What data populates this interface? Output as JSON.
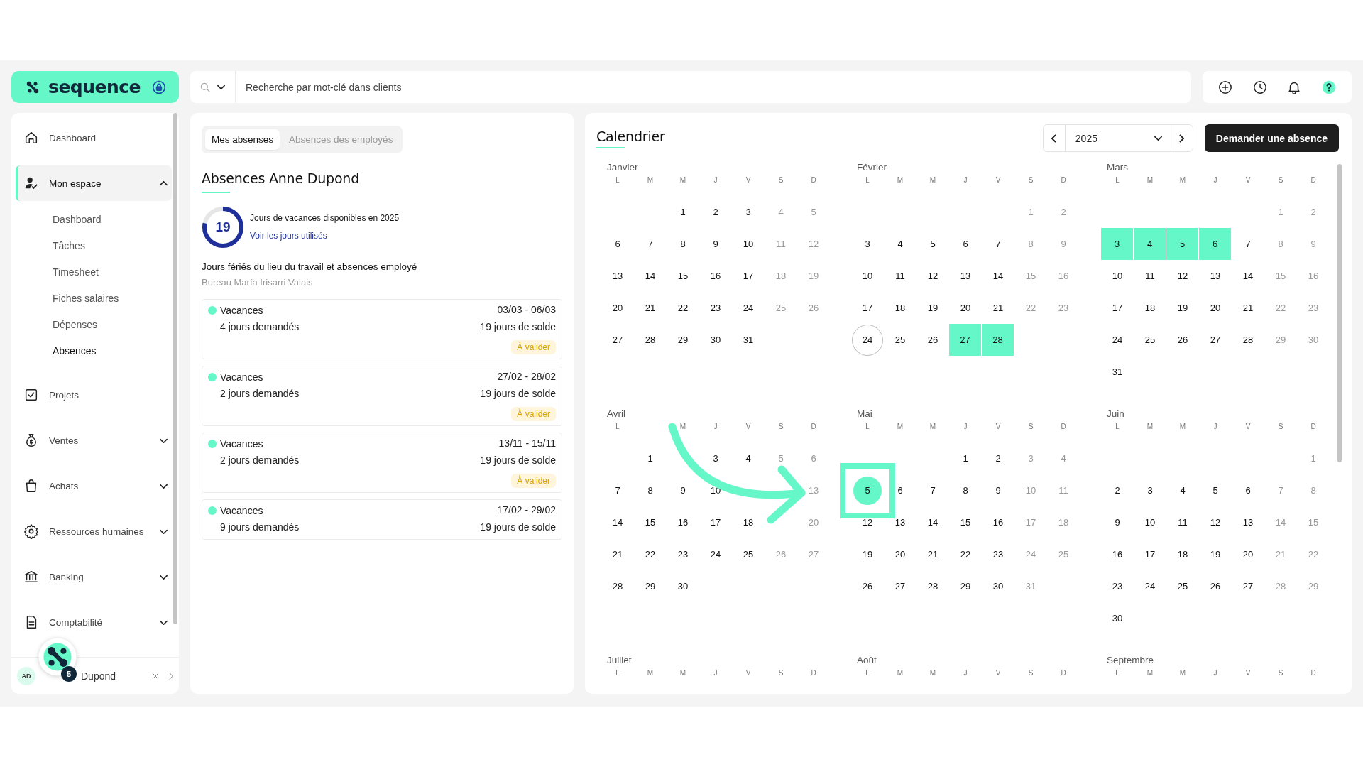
{
  "brand": {
    "name": "sequence"
  },
  "search": {
    "placeholder": "Recherche par mot-clé dans clients"
  },
  "sidebar": {
    "items": [
      {
        "label": "Dashboard",
        "kind": "link",
        "selected": false
      },
      {
        "label": "Mon espace",
        "kind": "group",
        "selected": true,
        "expanded": true,
        "children": [
          {
            "label": "Dashboard",
            "selected": false
          },
          {
            "label": "Tâches",
            "selected": false
          },
          {
            "label": "Timesheet",
            "selected": false
          },
          {
            "label": "Fiches salaires",
            "selected": false
          },
          {
            "label": "Dépenses",
            "selected": false
          },
          {
            "label": "Absences",
            "selected": true
          }
        ]
      },
      {
        "label": "Projets",
        "kind": "link",
        "selected": false
      },
      {
        "label": "Ventes",
        "kind": "group",
        "selected": false,
        "expanded": false
      },
      {
        "label": "Achats",
        "kind": "group",
        "selected": false,
        "expanded": false
      },
      {
        "label": "Ressources humaines",
        "kind": "group",
        "selected": false,
        "expanded": false
      },
      {
        "label": "Banking",
        "kind": "group",
        "selected": false,
        "expanded": false
      },
      {
        "label": "Comptabilité",
        "kind": "group",
        "selected": false,
        "expanded": false
      }
    ],
    "user": {
      "initials": "AD",
      "name": "Dupond"
    },
    "chat": {
      "badge": "5"
    }
  },
  "absences_panel": {
    "tabs": [
      {
        "label": "Mes absenses",
        "selected": true
      },
      {
        "label": "Absences des employés",
        "selected": false
      }
    ],
    "title": "Absences Anne Dupond",
    "balance": {
      "value": "19",
      "level": 0.78,
      "text": "Jours de vacances disponibles en 2025",
      "link": "Voir les jours utilisés"
    },
    "holidays_title": "Jours fériés du lieu du travail et absences employé",
    "location": "Bureau María Irisarri Valais",
    "requests": [
      {
        "type": "Vacances",
        "color": "#66f7c9",
        "dates": "03/03 - 06/03",
        "requested": "4 jours demandés",
        "balance": "19 jours de solde",
        "status": "À valider"
      },
      {
        "type": "Vacances",
        "color": "#66f7c9",
        "dates": "27/02 - 28/02",
        "requested": "2 jours demandés",
        "balance": "19 jours de solde",
        "status": "À valider"
      },
      {
        "type": "Vacances",
        "color": "#66f7c9",
        "dates": "13/11 - 15/11",
        "requested": "2 jours demandés",
        "balance": "19 jours de solde",
        "status": "À valider"
      },
      {
        "type": "Vacances",
        "color": "#66f7c9",
        "dates": "17/02 - 29/02",
        "requested": "9 jours demandés",
        "balance": "19 jours de solde"
      }
    ]
  },
  "calendar": {
    "title": "Calendrier",
    "year": "2025",
    "request_button": "Demander une absence",
    "months": [
      {
        "name": "Janvier",
        "weekdays": [
          "L",
          "M",
          "M",
          "J",
          "V",
          "S",
          "D"
        ],
        "weeks": [
          [
            "1",
            "2",
            "3",
            "4",
            "5"
          ],
          [
            "6",
            "7",
            "8",
            "9",
            "10",
            "11",
            "12"
          ],
          [
            "13",
            "14",
            "15",
            "16",
            "17",
            "18",
            "19"
          ],
          [
            "20",
            "21",
            "22",
            "23",
            "24",
            "25",
            "26"
          ],
          [
            "27",
            "28",
            "29",
            "30",
            "31"
          ]
        ]
      },
      {
        "name": "Février",
        "weekdays": [
          "L",
          "M",
          "M",
          "J",
          "V",
          "S",
          "D"
        ],
        "weeks": [
          [
            "1",
            "2"
          ],
          [
            "3",
            "4",
            "5",
            "6",
            "7",
            "8",
            "9"
          ],
          [
            "10",
            "11",
            "12",
            "13",
            "14",
            "15",
            "16"
          ],
          [
            "17",
            "18",
            "19",
            "20",
            "21",
            "22",
            "23"
          ],
          [
            {
              "day": "24",
              "kind": "today"
            },
            "25",
            "26",
            {
              "day": "27",
              "kind": "absence"
            },
            {
              "day": "28",
              "kind": "absence"
            }
          ]
        ]
      },
      {
        "name": "Mars",
        "weekdays": [
          "L",
          "M",
          "M",
          "J",
          "V",
          "S",
          "D"
        ],
        "weeks": [
          [
            "1",
            "2"
          ],
          [
            {
              "day": "3",
              "kind": "absence"
            },
            {
              "day": "4",
              "kind": "absence"
            },
            {
              "day": "5",
              "kind": "absence"
            },
            {
              "day": "6",
              "kind": "absence"
            },
            "7",
            "8",
            "9"
          ],
          [
            "10",
            "11",
            "12",
            "13",
            "14",
            "15",
            "16"
          ],
          [
            "17",
            "18",
            "19",
            "20",
            "21",
            "22",
            "23"
          ],
          [
            "24",
            "25",
            "26",
            "27",
            "28",
            "29",
            "30"
          ],
          [
            "31"
          ]
        ]
      },
      {
        "name": "Avril",
        "weekdays": [
          "L",
          {
            "kind": "covered"
          },
          "M",
          "J",
          "V",
          "S",
          "D"
        ],
        "weeks": [
          [
            "1",
            {
              "kind": "covered"
            },
            "3",
            "4",
            "5",
            "6"
          ],
          [
            "7",
            "8",
            "9",
            "10",
            {
              "kind": "covered"
            },
            {
              "kind": "covered"
            },
            "13"
          ],
          [
            "14",
            "15",
            "16",
            "17",
            "18",
            {
              "kind": "covered"
            },
            "20"
          ],
          [
            "21",
            "22",
            "23",
            "24",
            "25",
            "26",
            "27"
          ],
          [
            "28",
            "29",
            "30"
          ]
        ]
      },
      {
        "name": "Mai",
        "weekdays": [
          "L",
          "M",
          "M",
          "J",
          "V",
          "S",
          "D"
        ],
        "weeks": [
          [
            "1",
            "2",
            "3",
            "4"
          ],
          [
            {
              "day": "5",
              "kind": "focus"
            },
            "6",
            "7",
            "8",
            "9",
            "10",
            "11"
          ],
          [
            "12",
            "13",
            "14",
            "15",
            "16",
            "17",
            "18"
          ],
          [
            "19",
            "20",
            "21",
            "22",
            "23",
            "24",
            "25"
          ],
          [
            "26",
            "27",
            "28",
            "29",
            "30",
            "31"
          ]
        ]
      },
      {
        "name": "Juin",
        "weekdays": [
          "L",
          "M",
          "M",
          "J",
          "V",
          "S",
          "D"
        ],
        "weeks": [
          [
            "1"
          ],
          [
            "2",
            "3",
            "4",
            "5",
            "6",
            "7",
            "8"
          ],
          [
            "9",
            "10",
            "11",
            "12",
            "13",
            "14",
            "15"
          ],
          [
            "16",
            "17",
            "18",
            "19",
            "20",
            "21",
            "22"
          ],
          [
            "23",
            "24",
            "25",
            "26",
            "27",
            "28",
            "29"
          ],
          [
            "30"
          ]
        ]
      },
      {
        "name": "Juillet",
        "weekdays": [
          "L",
          "M",
          "M",
          "J",
          "V",
          "S",
          "D"
        ]
      },
      {
        "name": "Août",
        "weekdays": [
          "L",
          "M",
          "M",
          "J",
          "V",
          "S",
          "D"
        ]
      },
      {
        "name": "Septembre",
        "weekdays": [
          "L",
          "M",
          "M",
          "J",
          "V",
          "S",
          "D"
        ]
      }
    ]
  }
}
